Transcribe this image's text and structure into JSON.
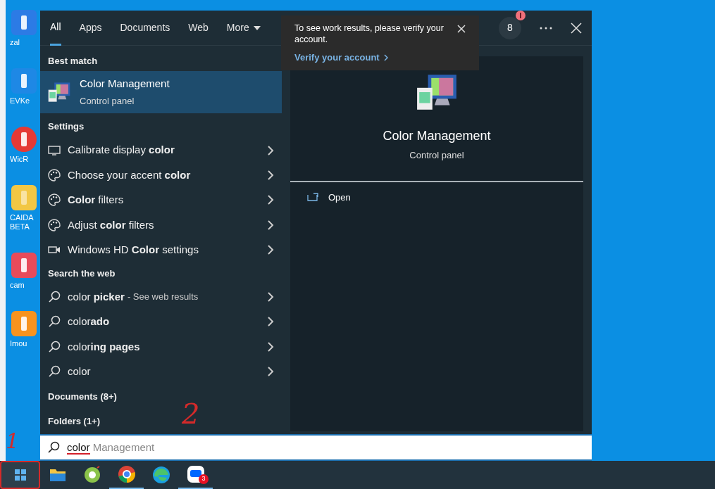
{
  "desktop_icons": [
    {
      "label": "zal",
      "kind": "chat"
    },
    {
      "label": "EVKe",
      "kind": "keyboard"
    },
    {
      "label": "WicR",
      "kind": "warning"
    },
    {
      "label": "CAIDA BETA",
      "kind": "folder"
    },
    {
      "label": "cam",
      "kind": "shop"
    },
    {
      "label": "Imou",
      "kind": "imou"
    }
  ],
  "search_panel": {
    "tabs": [
      {
        "label": "All",
        "selected": true
      },
      {
        "label": "Apps",
        "selected": false
      },
      {
        "label": "Documents",
        "selected": false
      },
      {
        "label": "Web",
        "selected": false
      },
      {
        "label": "More",
        "selected": false
      }
    ],
    "points": "8",
    "best_match": {
      "heading": "Best match",
      "title": "Color Management",
      "subtitle": "Control panel",
      "selected": true
    },
    "settings": {
      "heading": "Settings",
      "items": [
        {
          "text": "Calibrate display **color**",
          "kind": "display"
        },
        {
          "text": "Choose your accent **color**",
          "kind": "palette"
        },
        {
          "text": "**Color** filters",
          "kind": "palette"
        },
        {
          "text": "Adjust **color** filters",
          "kind": "palette"
        },
        {
          "text": "Windows HD **Color** settings",
          "kind": "video"
        }
      ]
    },
    "web": {
      "heading": "Search the web",
      "items": [
        {
          "text": "color **picker**",
          "suffix": "- See web results"
        },
        {
          "text": "color**ado**"
        },
        {
          "text": "color**ing pages**"
        },
        {
          "text": "color"
        }
      ]
    },
    "groups": [
      "Documents (8+)",
      "Folders (1+)"
    ],
    "preview": {
      "title": "Color Management",
      "subtitle": "Control panel",
      "actions": [
        "Open"
      ]
    },
    "search_box": {
      "value": "color",
      "suggestion": " Management"
    }
  },
  "notification": {
    "message": "To see work results, please verify your account.",
    "link": "Verify your account"
  },
  "taskbar": {
    "apps": [
      {
        "kind": "folder",
        "active": false
      },
      {
        "kind": "coccoc",
        "active": false
      },
      {
        "kind": "chrome",
        "active": true
      },
      {
        "kind": "edge",
        "active": false
      },
      {
        "kind": "zalo",
        "active": true,
        "badge": "3"
      }
    ]
  },
  "annotations": [
    "1",
    "2"
  ]
}
